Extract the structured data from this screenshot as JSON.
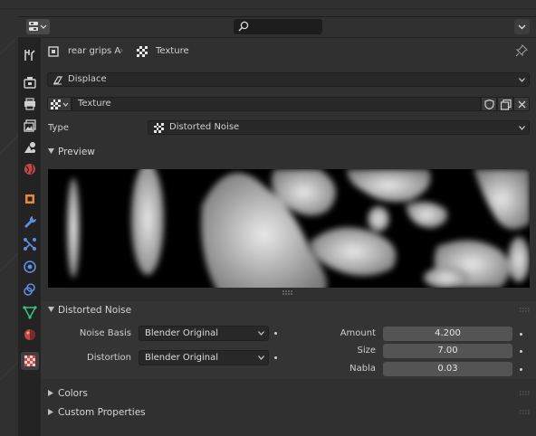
{
  "header": {
    "editor_type_icon": "properties-editor-icon",
    "search": {
      "placeholder": ""
    }
  },
  "tabs": [
    {
      "name": "tool",
      "icon": "tool-icon"
    },
    {
      "name": "render",
      "icon": "camera-back-icon"
    },
    {
      "name": "output",
      "icon": "printer-icon"
    },
    {
      "name": "view-layer",
      "icon": "image-icon"
    },
    {
      "name": "scene",
      "icon": "scene-icon"
    },
    {
      "name": "world",
      "icon": "world-icon"
    },
    {
      "name": "object",
      "icon": "object-icon"
    },
    {
      "name": "modifiers",
      "icon": "wrench-icon"
    },
    {
      "name": "particles",
      "icon": "particles-icon"
    },
    {
      "name": "physics",
      "icon": "physics-icon"
    },
    {
      "name": "constraints",
      "icon": "constraint-icon"
    },
    {
      "name": "data",
      "icon": "mesh-data-icon"
    },
    {
      "name": "material",
      "icon": "material-icon"
    },
    {
      "name": "texture",
      "icon": "texture-icon",
      "active": true
    }
  ],
  "breadcrumb": {
    "object": "rear grips A",
    "texture": "Texture"
  },
  "context": {
    "modifier": "Displace"
  },
  "texture_block": {
    "name": "Texture",
    "type_label": "Type",
    "type_value": "Distorted Noise"
  },
  "preview": {
    "title": "Preview"
  },
  "distorted_noise": {
    "title": "Distorted Noise",
    "noise_basis_label": "Noise Basis",
    "noise_basis_value": "Blender Original",
    "distortion_label": "Distortion",
    "distortion_value": "Blender Original",
    "amount_label": "Amount",
    "amount_value": "4.200",
    "size_label": "Size",
    "size_value": "7.00",
    "nabla_label": "Nabla",
    "nabla_value": "0.03"
  },
  "collapsed_panels": {
    "colors": "Colors",
    "custom_properties": "Custom Properties"
  },
  "colors": {
    "background": "#303030",
    "field": "#545454",
    "dropdown": "#282828",
    "accent_texture": "#d84a4a"
  }
}
